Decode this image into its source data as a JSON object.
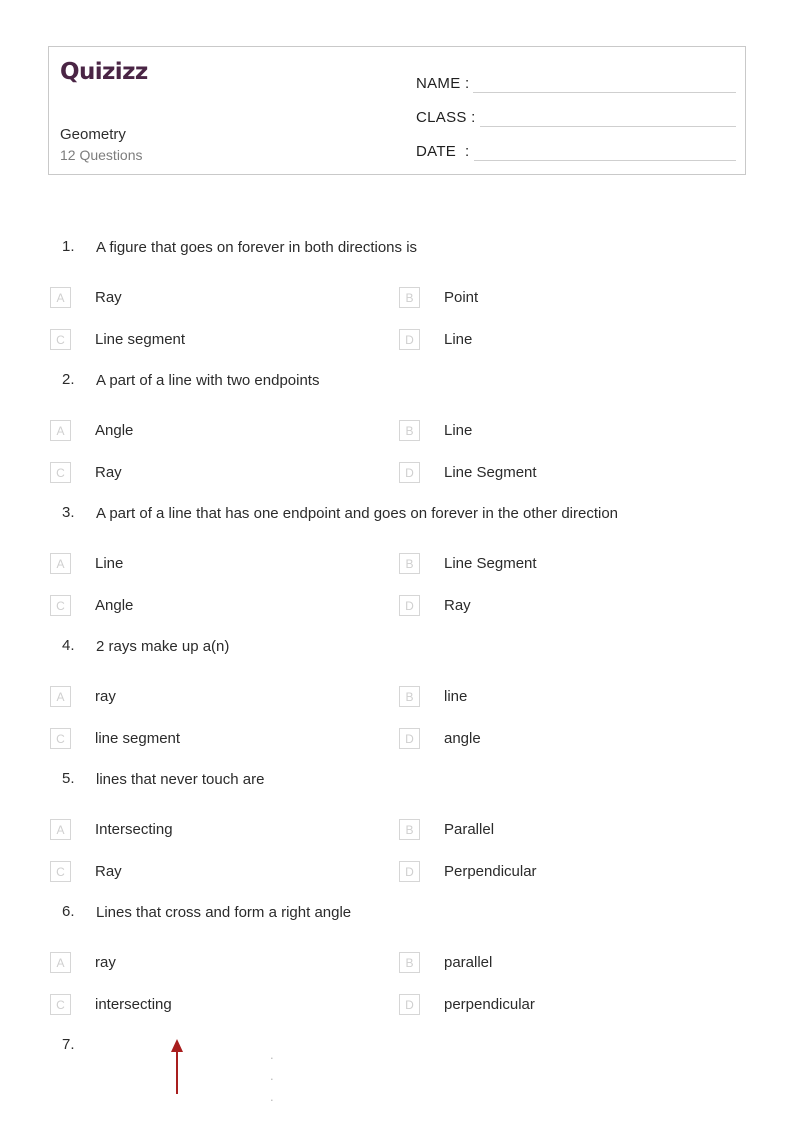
{
  "header": {
    "logo_text": "Quizizz",
    "quiz_title": "Geometry",
    "question_count_label": "12 Questions",
    "fields": [
      {
        "label": "NAME :",
        "value": ""
      },
      {
        "label": "CLASS :",
        "value": ""
      },
      {
        "label": "DATE  :",
        "value": ""
      }
    ]
  },
  "colors": {
    "logo_purple": "#4a2545",
    "arrow_red": "#a81e1e",
    "border_gray": "#c9c9c9",
    "option_box_border": "#d6d6d6",
    "option_letter_gray": "#cfcfcf",
    "subtitle_gray": "#7d7d7d",
    "text_dark": "#2b2b2b"
  },
  "questions": [
    {
      "number": "1.",
      "text": "A figure that goes on forever in both directions is",
      "options": [
        {
          "letter": "A",
          "label": "Ray"
        },
        {
          "letter": "B",
          "label": "Point"
        },
        {
          "letter": "C",
          "label": "Line segment"
        },
        {
          "letter": "D",
          "label": "Line"
        }
      ]
    },
    {
      "number": "2.",
      "text": "A part of a line with two endpoints",
      "options": [
        {
          "letter": "A",
          "label": "Angle"
        },
        {
          "letter": "B",
          "label": "Line"
        },
        {
          "letter": "C",
          "label": "Ray"
        },
        {
          "letter": "D",
          "label": "Line Segment"
        }
      ]
    },
    {
      "number": "3.",
      "text": "A part of a line that has one endpoint and goes on forever in the other direction",
      "options": [
        {
          "letter": "A",
          "label": "Line"
        },
        {
          "letter": "B",
          "label": "Line Segment"
        },
        {
          "letter": "C",
          "label": "Angle"
        },
        {
          "letter": "D",
          "label": "Ray"
        }
      ]
    },
    {
      "number": "4.",
      "text": "2 rays make up a(n)",
      "options": [
        {
          "letter": "A",
          "label": "ray"
        },
        {
          "letter": "B",
          "label": "line"
        },
        {
          "letter": "C",
          "label": "line segment"
        },
        {
          "letter": "D",
          "label": "angle"
        }
      ]
    },
    {
      "number": "5.",
      "text": "lines that never touch are",
      "options": [
        {
          "letter": "A",
          "label": "Intersecting"
        },
        {
          "letter": "B",
          "label": "Parallel"
        },
        {
          "letter": "C",
          "label": "Ray"
        },
        {
          "letter": "D",
          "label": "Perpendicular"
        }
      ]
    },
    {
      "number": "6.",
      "text": "Lines that cross and form a right angle",
      "options": [
        {
          "letter": "A",
          "label": "ray"
        },
        {
          "letter": "B",
          "label": "parallel"
        },
        {
          "letter": "C",
          "label": "intersecting"
        },
        {
          "letter": "D",
          "label": "perpendicular"
        }
      ]
    }
  ],
  "partial_question": {
    "number": "7.",
    "figure": "up-arrow-red",
    "dots": "."
  }
}
